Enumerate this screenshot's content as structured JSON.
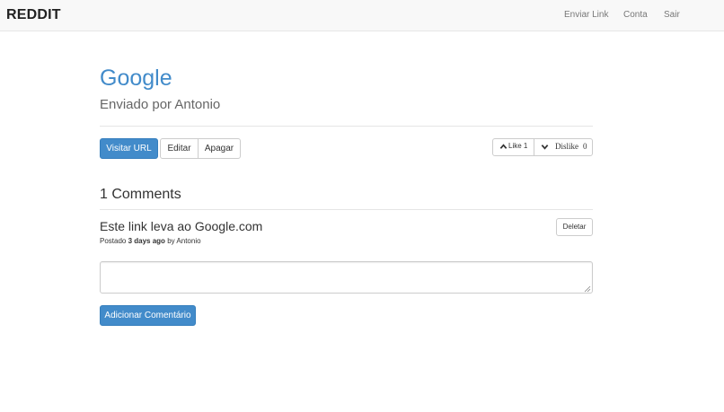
{
  "navbar": {
    "brand": "REDDIT",
    "links": [
      "Enviar Link",
      "Conta",
      "Sair"
    ]
  },
  "post": {
    "title": "Google",
    "subtitle": "Enviado por Antonio",
    "buttons": {
      "visit": "Visitar URL",
      "edit": "Editar",
      "delete": "Apagar"
    },
    "votes": {
      "like_label": "Like 1",
      "dislike_label": "Dislike",
      "dislike_count": "0"
    }
  },
  "comments": {
    "count_label": "1 Comments",
    "items": [
      {
        "body": "Este link leva ao Google.com",
        "meta_prefix": "Postado",
        "meta_time": "3 days ago",
        "meta_by": "by Antonio",
        "delete_label": "Deletar"
      }
    ],
    "input_value": "",
    "submit_label": "Adicionar Comentário"
  },
  "colors": {
    "accent": "#428bca",
    "navbar_bg": "#f8f8f8"
  }
}
